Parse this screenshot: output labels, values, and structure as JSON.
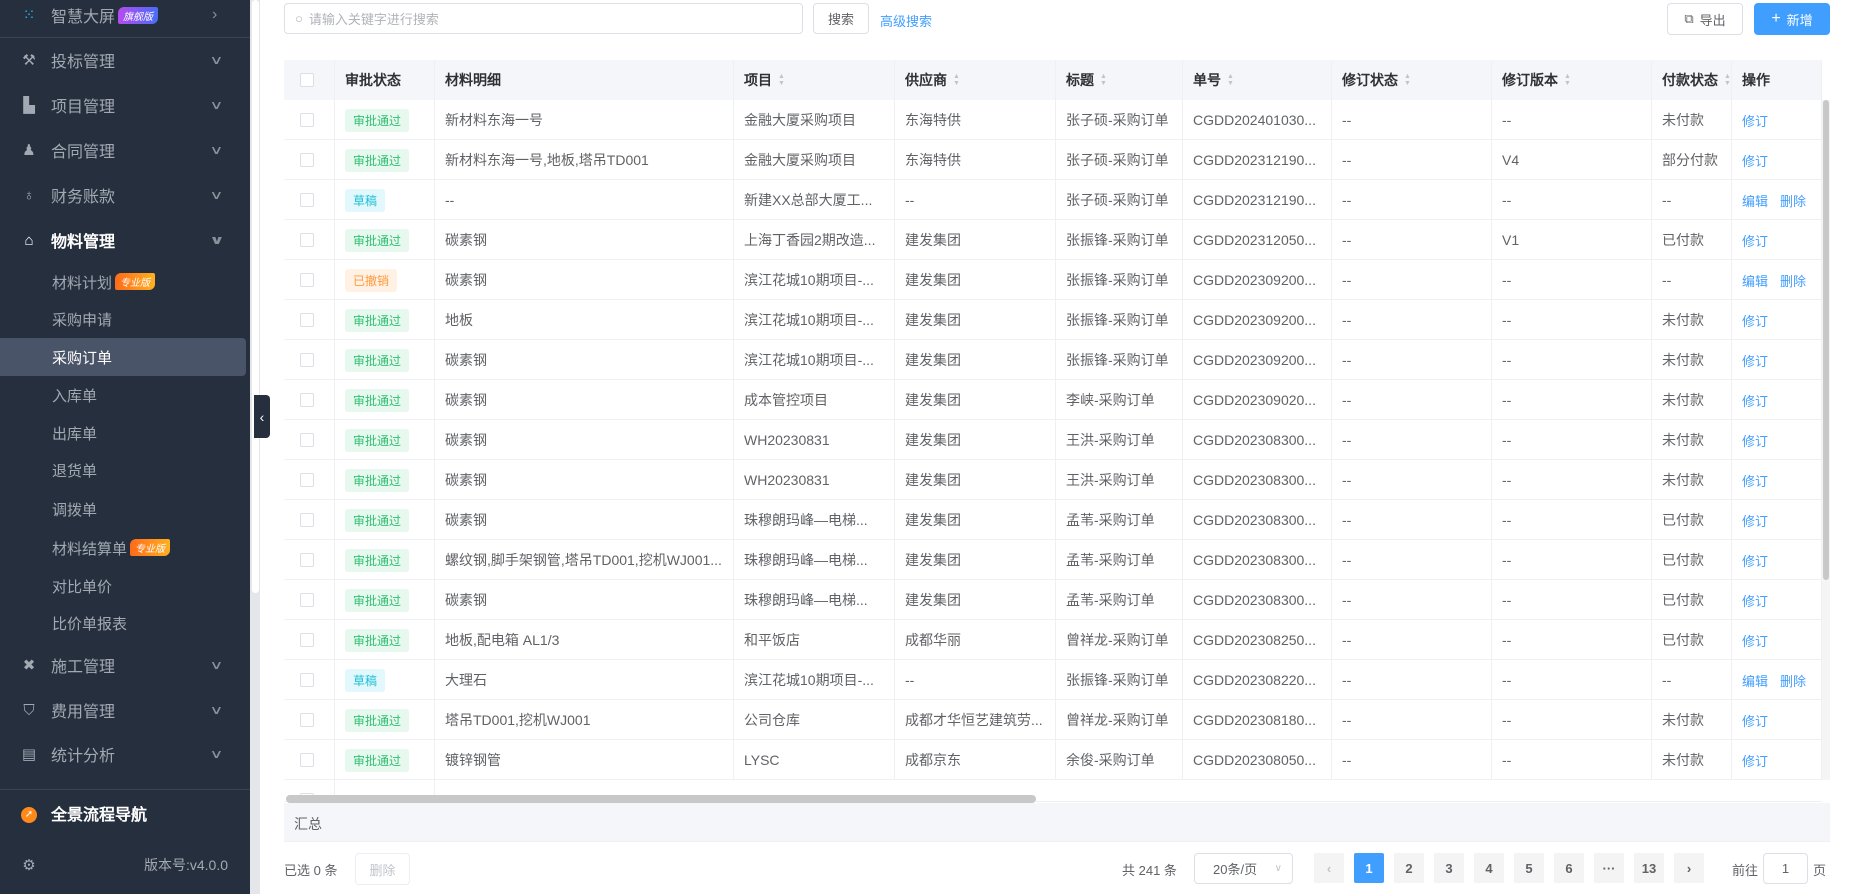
{
  "sidebar": {
    "top": {
      "label": "智慧大屏",
      "badge": "旗舰版",
      "icon": "dots-icon"
    },
    "groups": [
      {
        "label": "投标管理",
        "icon": "gavel-icon"
      },
      {
        "label": "项目管理",
        "icon": "building-icon"
      },
      {
        "label": "合同管理",
        "icon": "stamp-icon"
      },
      {
        "label": "财务账款",
        "icon": "money-bag-icon"
      },
      {
        "label": "物料管理",
        "icon": "warehouse-icon"
      }
    ],
    "sub_items": [
      {
        "label": "材料计划",
        "badge": "专业版"
      },
      {
        "label": "采购申请"
      },
      {
        "label": "采购订单",
        "active": true
      },
      {
        "label": "入库单"
      },
      {
        "label": "出库单"
      },
      {
        "label": "退货单"
      },
      {
        "label": "调拨单"
      },
      {
        "label": "材料结算单",
        "badge": "专业版"
      },
      {
        "label": "对比单价"
      },
      {
        "label": "比价单报表"
      }
    ],
    "groups2": [
      {
        "label": "施工管理",
        "icon": "tools-icon"
      },
      {
        "label": "费用管理",
        "icon": "shield-yen-icon"
      },
      {
        "label": "统计分析",
        "icon": "chart-box-icon"
      }
    ],
    "nav_guide": "全景流程导航",
    "version": "版本号:v4.0.0"
  },
  "toolbar": {
    "search_placeholder": "请输入关键字进行搜索",
    "search": "搜索",
    "advanced": "高级搜索",
    "export": "导出",
    "add": "新增"
  },
  "colors": {
    "accent": "#409eff",
    "approved": "#2fbf71",
    "draft": "#1cc0d8",
    "revoked": "#ff9a3c"
  },
  "table": {
    "columns": [
      "审批状态",
      "材料明细",
      "项目",
      "供应商",
      "标题",
      "单号",
      "修订状态",
      "修订版本",
      "付款状态",
      "操作"
    ],
    "rows": [
      [
        "审批通过",
        "新材料东海一号",
        "金融大厦采购项目",
        "东海特供",
        "张子硕-采购订单",
        "CGDD202401030...",
        "--",
        "--",
        "未付款",
        [
          "修订"
        ]
      ],
      [
        "审批通过",
        "新材料东海一号,地板,塔吊TD001",
        "金融大厦采购项目",
        "东海特供",
        "张子硕-采购订单",
        "CGDD202312190...",
        "--",
        "V4",
        "部分付款",
        [
          "修订"
        ]
      ],
      [
        "草稿",
        "--",
        "新建XX总部大厦工...",
        "--",
        "张子硕-采购订单",
        "CGDD202312190...",
        "--",
        "--",
        "--",
        [
          "编辑",
          "删除"
        ]
      ],
      [
        "审批通过",
        "碳素钢",
        "上海丁香园2期改造...",
        "建发集团",
        "张振锋-采购订单",
        "CGDD202312050...",
        "--",
        "V1",
        "已付款",
        [
          "修订"
        ]
      ],
      [
        "已撤销",
        "碳素钢",
        "滨江花城10期项目-...",
        "建发集团",
        "张振锋-采购订单",
        "CGDD202309200...",
        "--",
        "--",
        "--",
        [
          "编辑",
          "删除"
        ]
      ],
      [
        "审批通过",
        "地板",
        "滨江花城10期项目-...",
        "建发集团",
        "张振锋-采购订单",
        "CGDD202309200...",
        "--",
        "--",
        "未付款",
        [
          "修订"
        ]
      ],
      [
        "审批通过",
        "碳素钢",
        "滨江花城10期项目-...",
        "建发集团",
        "张振锋-采购订单",
        "CGDD202309200...",
        "--",
        "--",
        "未付款",
        [
          "修订"
        ]
      ],
      [
        "审批通过",
        "碳素钢",
        "成本管控项目",
        "建发集团",
        "李峡-采购订单",
        "CGDD202309020...",
        "--",
        "--",
        "未付款",
        [
          "修订"
        ]
      ],
      [
        "审批通过",
        "碳素钢",
        "WH20230831",
        "建发集团",
        "王洪-采购订单",
        "CGDD202308300...",
        "--",
        "--",
        "未付款",
        [
          "修订"
        ]
      ],
      [
        "审批通过",
        "碳素钢",
        "WH20230831",
        "建发集团",
        "王洪-采购订单",
        "CGDD202308300...",
        "--",
        "--",
        "未付款",
        [
          "修订"
        ]
      ],
      [
        "审批通过",
        "碳素钢",
        "珠穆朗玛峰—电梯...",
        "建发集团",
        "孟苇-采购订单",
        "CGDD202308300...",
        "--",
        "--",
        "已付款",
        [
          "修订"
        ]
      ],
      [
        "审批通过",
        "螺纹钢,脚手架钢管,塔吊TD001,挖机WJ001...",
        "珠穆朗玛峰—电梯...",
        "建发集团",
        "孟苇-采购订单",
        "CGDD202308300...",
        "--",
        "--",
        "已付款",
        [
          "修订"
        ]
      ],
      [
        "审批通过",
        "碳素钢",
        "珠穆朗玛峰—电梯...",
        "建发集团",
        "孟苇-采购订单",
        "CGDD202308300...",
        "--",
        "--",
        "已付款",
        [
          "修订"
        ]
      ],
      [
        "审批通过",
        "地板,配电箱 AL1/3",
        "和平饭店",
        "成都华丽",
        "曾祥龙-采购订单",
        "CGDD202308250...",
        "--",
        "--",
        "已付款",
        [
          "修订"
        ]
      ],
      [
        "草稿",
        "大理石",
        "滨江花城10期项目-...",
        "--",
        "张振锋-采购订单",
        "CGDD202308220...",
        "--",
        "--",
        "--",
        [
          "编辑",
          "删除"
        ]
      ],
      [
        "审批通过",
        "塔吊TD001,挖机WJ001",
        "公司仓库",
        "成都才华恒艺建筑劳...",
        "曾祥龙-采购订单",
        "CGDD202308180...",
        "--",
        "--",
        "未付款",
        [
          "修订"
        ]
      ],
      [
        "审批通过",
        "镀锌钢管",
        "LYSC",
        "成都京东",
        "余俊-采购订单",
        "CGDD202308050...",
        "--",
        "--",
        "未付款",
        [
          "修订"
        ]
      ]
    ],
    "summary_label": "汇总"
  },
  "footer": {
    "selected": "已选 0 条",
    "delete": "删除",
    "total": "共 241 条",
    "page_size": "20条/页",
    "pages": [
      "1",
      "2",
      "3",
      "4",
      "5",
      "6",
      "···",
      "13"
    ],
    "current_page": "1",
    "goto": "前往",
    "goto_value": "1",
    "page_unit": "页"
  }
}
